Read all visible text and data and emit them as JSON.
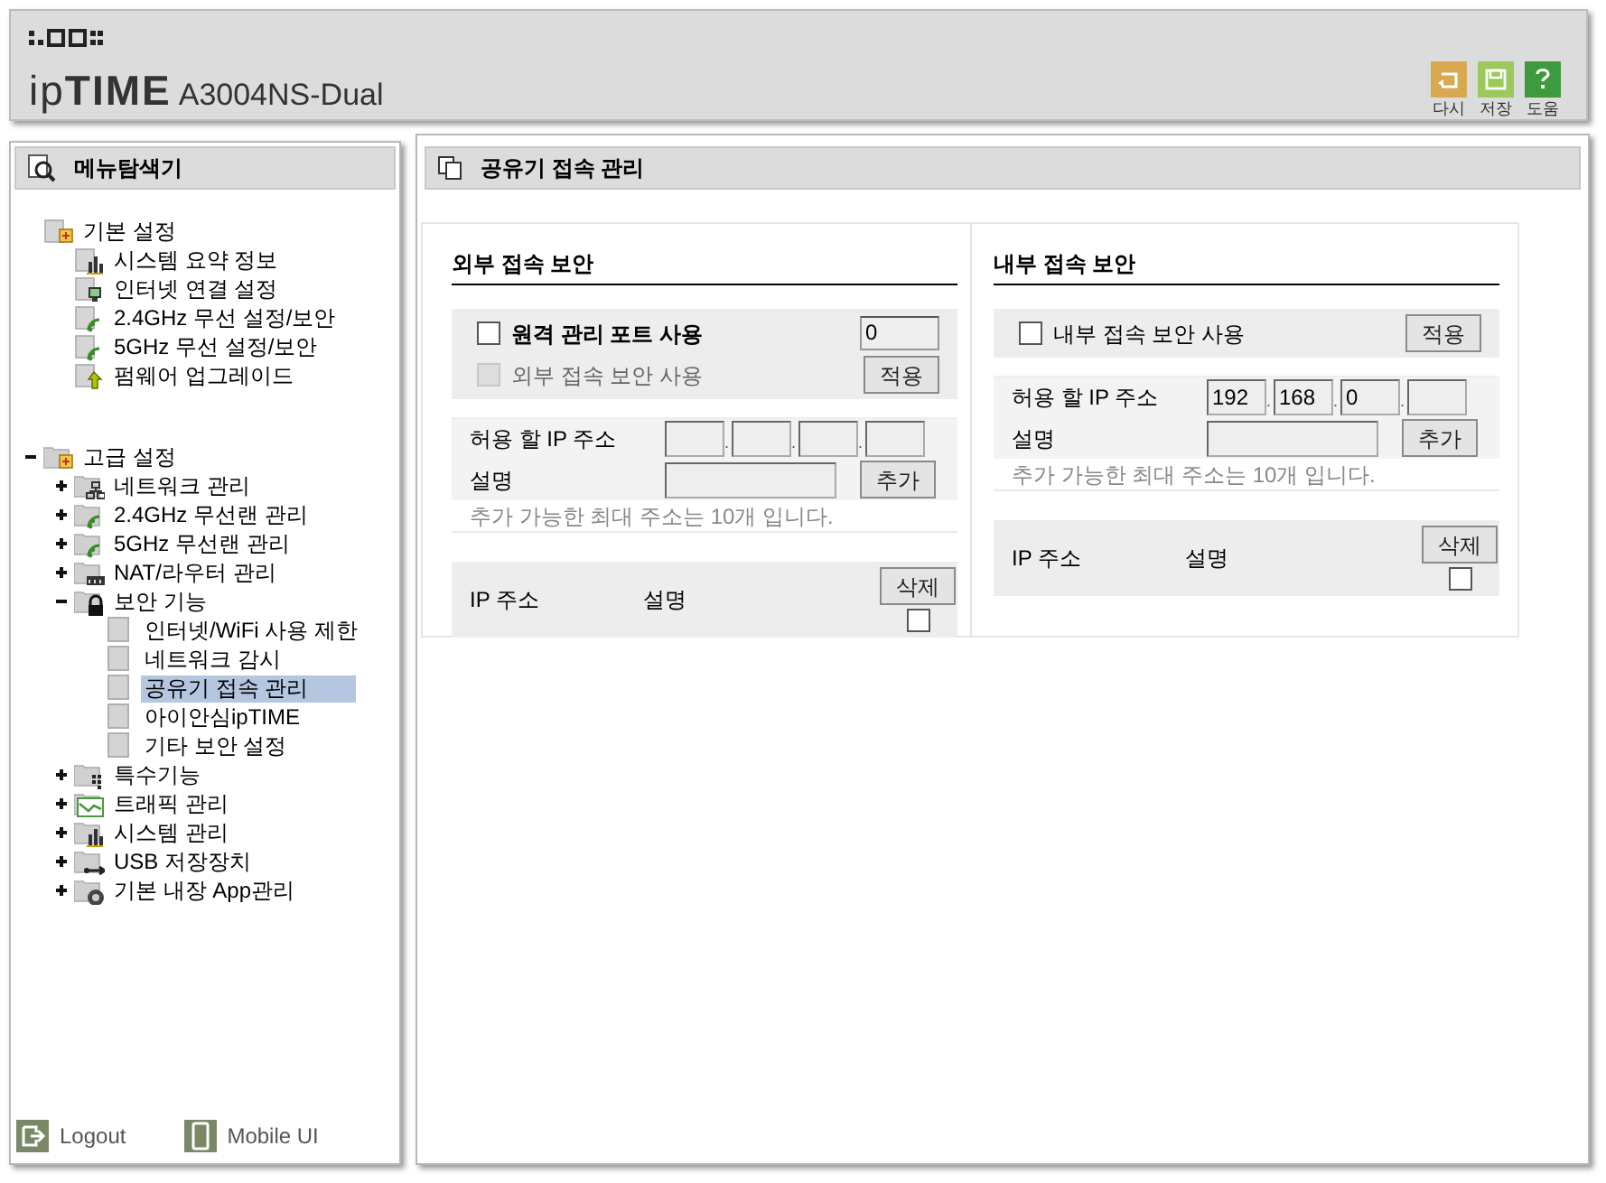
{
  "header": {
    "logo": "ip**TIME**",
    "model": "A3004NS-Dual",
    "tools": [
      {
        "kind": "undo",
        "label": "다시"
      },
      {
        "kind": "save",
        "label": "저장"
      },
      {
        "kind": "help",
        "label": "도움"
      }
    ]
  },
  "sidebar": {
    "title": "메뉴탐색기",
    "tree": [
      {
        "label": "기본 설정",
        "kind": "folder-add",
        "selected": false,
        "children": [
          {
            "label": "시스템 요약 정보",
            "kind": "chart",
            "selected": false
          },
          {
            "label": "인터넷 연결 설정",
            "kind": "monitor",
            "selected": false
          },
          {
            "label": "2.4GHz 무선 설정/보안",
            "kind": "wifi",
            "selected": false
          },
          {
            "label": "5GHz 무선 설정/보안",
            "kind": "wifi",
            "selected": false
          },
          {
            "label": "펌웨어 업그레이드",
            "kind": "upgrade",
            "selected": false
          }
        ]
      },
      {
        "label": "고급 설정",
        "kind": "folder-add",
        "selected": false,
        "expanded": true,
        "children": [
          {
            "label": "네트워크 관리",
            "kind": "network",
            "selected": false,
            "expanded": false
          },
          {
            "label": "2.4GHz 무선랜 관리",
            "kind": "wifi",
            "selected": false,
            "expanded": false
          },
          {
            "label": "5GHz 무선랜 관리",
            "kind": "wifi",
            "selected": false,
            "expanded": false
          },
          {
            "label": "NAT/라우터 관리",
            "kind": "router",
            "selected": false,
            "expanded": false
          },
          {
            "label": "보안 기능",
            "kind": "lock",
            "selected": false,
            "expanded": true,
            "children": [
              {
                "label": "인터넷/WiFi 사용 제한",
                "kind": "page",
                "selected": false
              },
              {
                "label": "네트워크 감시",
                "kind": "page",
                "selected": false
              },
              {
                "label": "공유기 접속 관리",
                "kind": "page",
                "selected": true
              },
              {
                "label": "아이안심ipTIME",
                "kind": "page",
                "selected": false
              },
              {
                "label": "기타 보안 설정",
                "kind": "page",
                "selected": false
              }
            ]
          },
          {
            "label": "특수기능",
            "kind": "grid",
            "selected": false,
            "expanded": false
          },
          {
            "label": "트래픽 관리",
            "kind": "traffic",
            "selected": false,
            "expanded": false
          },
          {
            "label": "시스템 관리",
            "kind": "chart",
            "selected": false,
            "expanded": false
          },
          {
            "label": "USB 저장장치",
            "kind": "usb",
            "selected": false,
            "expanded": false
          },
          {
            "label": "기본 내장 App관리",
            "kind": "app",
            "selected": false,
            "expanded": false
          }
        ]
      }
    ],
    "footer": [
      {
        "kind": "logout",
        "label": "Logout"
      },
      {
        "kind": "mobile",
        "label": "Mobile UI"
      }
    ]
  },
  "main": {
    "title": "공유기 접속 관리",
    "sections": [
      {
        "title": "외부 접속 보안",
        "options": [
          {
            "kind": "port",
            "label": "원격 관리 포트 사용",
            "checked": false,
            "disabled": false,
            "port": "0"
          },
          {
            "kind": "plain",
            "label": "외부 접속 보안 사용",
            "checked": false,
            "disabled": true
          }
        ],
        "apply_button": "적용",
        "ip_label": "허용 할 IP 주소",
        "ip_fields": [
          {
            "kind": "octet"
          },
          {
            "kind": "dot",
            "text": "."
          },
          {
            "kind": "octet"
          },
          {
            "kind": "dot",
            "text": "."
          },
          {
            "kind": "octet"
          },
          {
            "kind": "dot",
            "text": "."
          },
          {
            "kind": "octet"
          }
        ],
        "desc_label": "설명",
        "add_button": "추가",
        "note": "추가 가능한 최대 주소는 10개 입니다.",
        "table": {
          "columns": [
            "IP 주소",
            "설명"
          ],
          "delete_button": "삭제",
          "select_all_checked": false
        }
      },
      {
        "title": "내부 접속 보안",
        "options": [
          {
            "kind": "plain",
            "label": "내부 접속 보안 사용",
            "checked": false,
            "disabled": false
          }
        ],
        "apply_button": "적용",
        "ip_label": "허용 할 IP 주소",
        "ip_fields": [
          {
            "kind": "octet",
            "value": "192"
          },
          {
            "kind": "dot",
            "text": "."
          },
          {
            "kind": "octet",
            "value": "168"
          },
          {
            "kind": "dot",
            "text": "."
          },
          {
            "kind": "octet",
            "value": "0"
          },
          {
            "kind": "dot",
            "text": "."
          },
          {
            "kind": "octet"
          }
        ],
        "desc_label": "설명",
        "add_button": "추가",
        "note": "추가 가능한 최대 주소는 10개 입니다.",
        "table": {
          "columns": [
            "IP 주소",
            "설명"
          ],
          "delete_button": "삭제",
          "select_all_checked": false
        }
      }
    ]
  }
}
